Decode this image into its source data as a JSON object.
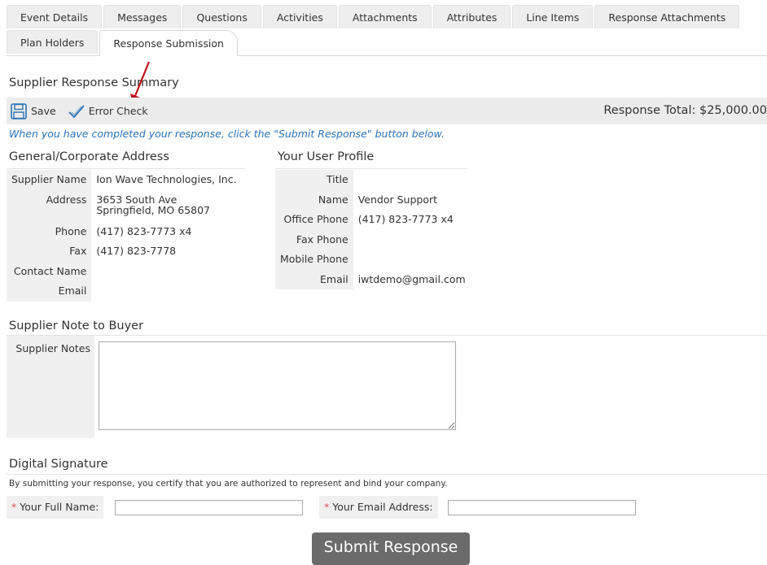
{
  "tabs_row1": [
    "Event Details",
    "Messages",
    "Questions",
    "Activities",
    "Attachments",
    "Attributes",
    "Line Items",
    "Response Attachments"
  ],
  "tabs_row2": [
    "Plan Holders",
    "Response Submission"
  ],
  "page_title": "Supplier Response Summary",
  "toolbar": {
    "save_label": "Save",
    "error_check_label": "Error Check",
    "response_total": "Response Total: $25,000.00"
  },
  "hint": "When you have completed your response, click the \"Submit Response\" button below.",
  "address": {
    "title": "General/Corporate Address",
    "rows": [
      {
        "label": "Supplier Name",
        "value": "Ion Wave Technologies, Inc."
      },
      {
        "label": "Address",
        "value": "3653 South Ave",
        "value2": "Springfield, MO 65807"
      },
      {
        "label": "Phone",
        "value": "(417) 823-7773 x4"
      },
      {
        "label": "Fax",
        "value": "(417) 823-7778"
      },
      {
        "label": "Contact Name",
        "value": ""
      },
      {
        "label": "Email",
        "value": ""
      }
    ]
  },
  "profile": {
    "title": "Your User Profile",
    "rows": [
      {
        "label": "Title",
        "value": ""
      },
      {
        "label": "Name",
        "value": "Vendor Support"
      },
      {
        "label": "Office Phone",
        "value": "(417) 823-7773 x4"
      },
      {
        "label": "Fax Phone",
        "value": ""
      },
      {
        "label": "Mobile Phone",
        "value": ""
      },
      {
        "label": "Email",
        "value": "iwtdemo@gmail.com"
      }
    ]
  },
  "notes": {
    "title": "Supplier Note to Buyer",
    "label": "Supplier Notes",
    "value": ""
  },
  "signature": {
    "title": "Digital Signature",
    "text": "By submitting your response, you certify that you are authorized to represent and bind your company.",
    "required_mark": "*",
    "full_name_label": "Your Full Name:",
    "full_name_value": "",
    "email_label": "Your Email Address:",
    "email_value": ""
  },
  "submit_label": "Submit Response",
  "colors": {
    "hint": "#2b73b8",
    "icon": "#2b73b8",
    "arrow": "#c0121b",
    "submit_bg": "#6b6b6b"
  }
}
